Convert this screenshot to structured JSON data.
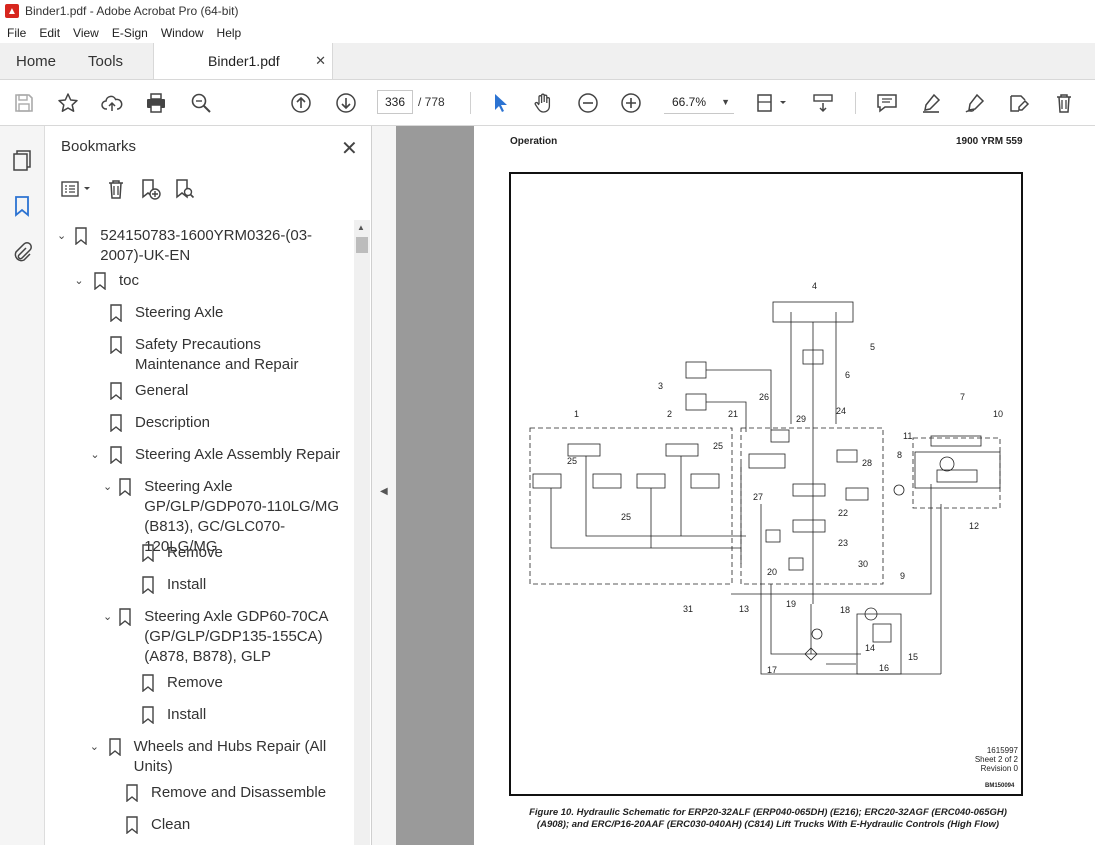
{
  "window": {
    "title": "Binder1.pdf - Adobe Acrobat Pro (64-bit)"
  },
  "menu": [
    "File",
    "Edit",
    "View",
    "E-Sign",
    "Window",
    "Help"
  ],
  "tabs": {
    "home": "Home",
    "tools": "Tools",
    "document": "Binder1.pdf"
  },
  "toolbar": {
    "current_page": "336",
    "total_pages": "/ 778",
    "zoom": "66.7%"
  },
  "bookmarks": {
    "title": "Bookmarks",
    "items": [
      {
        "label": "524150783-1600YRM0326-(03-2007)-UK-EN",
        "level": 0,
        "expanded": true
      },
      {
        "label": "toc",
        "level": 1,
        "expanded": true
      },
      {
        "label": "Steering Axle",
        "level": 2
      },
      {
        "label": "Safety Precautions Maintenance and Repair",
        "level": 2
      },
      {
        "label": "General",
        "level": 2
      },
      {
        "label": "Description",
        "level": 2
      },
      {
        "label": "Steering Axle Assembly Repair",
        "level": 2,
        "expanded": true
      },
      {
        "label": "Steering Axle GP/GLP/GDP070-110LG/MG (B813), GC/GLC070-120LG/MG",
        "level": 3,
        "expanded": true
      },
      {
        "label": "Remove",
        "level": 4
      },
      {
        "label": "Install",
        "level": 4
      },
      {
        "label": "Steering Axle GDP60-70CA (GP/GLP/GDP135-155CA) (A878, B878), GLP",
        "level": 3,
        "expanded": true
      },
      {
        "label": "Remove",
        "level": 4
      },
      {
        "label": "Install",
        "level": 4
      },
      {
        "label": "Wheels and Hubs Repair (All Units)",
        "level": 2,
        "expanded": true
      },
      {
        "label": "Remove and Disassemble",
        "level": 3
      },
      {
        "label": "Clean",
        "level": 3
      }
    ]
  },
  "pdf": {
    "header_left": "Operation",
    "header_right": "1900 YRM 559",
    "note_lines": [
      "1615997",
      "Sheet 2 of 2",
      "Revision 0"
    ],
    "code": "BM150094",
    "caption_line1": "Figure 10. Hydraulic Schematic for ERP20-32ALF (ERP040-065DH) (E216); ERC20-32AGF (ERC040-065GH)",
    "caption_line2": "(A908); and ERC/P16-20AAF (ERC030-040AH) (C814) Lift Trucks With E-Hydraulic Controls (High Flow)",
    "callouts": [
      "4",
      "5",
      "6",
      "3",
      "1",
      "2",
      "21",
      "26",
      "29",
      "24",
      "7",
      "10",
      "11",
      "8",
      "25",
      "25",
      "25",
      "28",
      "22",
      "27",
      "23",
      "12",
      "20",
      "19",
      "30",
      "31",
      "13",
      "9",
      "18",
      "14",
      "15",
      "17",
      "16"
    ]
  },
  "colors": {
    "acrobat_red": "#d7261e",
    "accent_blue": "#2c73d2",
    "viewer_bg": "#9a9a9a"
  }
}
